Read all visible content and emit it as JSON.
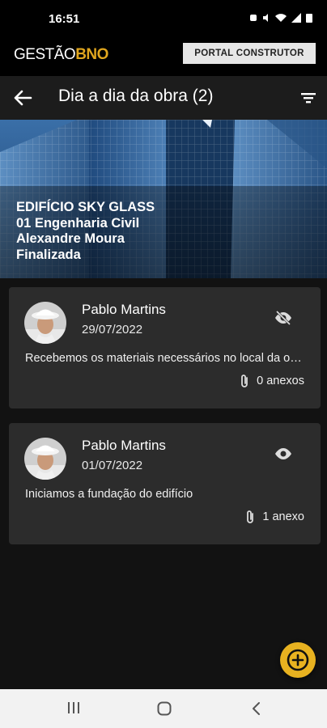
{
  "status_bar": {
    "time": "16:51"
  },
  "brand": {
    "logo_text": "GESTÃO",
    "logo_accent": "BNO",
    "portal_button": "PORTAL CONSTRUTOR"
  },
  "app_bar": {
    "title": "Dia a dia da obra (2)"
  },
  "project": {
    "name": "EDIFÍCIO SKY GLASS",
    "company": "01 Engenharia Civil",
    "responsible": "Alexandre Moura",
    "status": "Finalizada"
  },
  "entries": [
    {
      "author": "Pablo Martins",
      "date": "29/07/2022",
      "message": "Recebemos os materiais necessários no local da obra",
      "attachments": "0 anexos",
      "seen_icon": "eye-off-icon"
    },
    {
      "author": "Pablo Martins",
      "date": "01/07/2022",
      "message": "Iniciamos a fundação do edifício",
      "attachments": "1 anexo",
      "seen_icon": "eye-icon"
    }
  ],
  "colors": {
    "accent": "#e8b220",
    "card": "#2c2c2c",
    "background": "#121212"
  }
}
